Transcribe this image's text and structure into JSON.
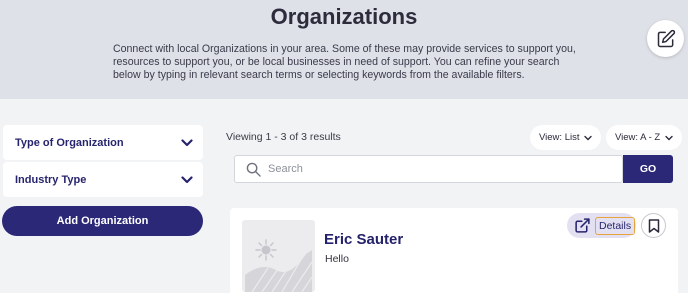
{
  "header": {
    "title": "Organizations",
    "intro": "Connect with local Organizations in your area. Some of these may provide services to support you, resources to support you, or be local businesses in need of support. You can refine your search below by typing in relevant search terms or selecting keywords from the available filters.",
    "edit_icon": "edit-icon"
  },
  "filters": [
    {
      "label": "Type of Organization",
      "icon": "chevron-down-icon"
    },
    {
      "label": "Industry Type",
      "icon": "chevron-down-icon"
    }
  ],
  "add_organization_label": "Add Organization",
  "results": {
    "count_text": "Viewing 1 - 3 of 3 results",
    "view_mode": "View: List",
    "sort": "View: A - Z"
  },
  "search": {
    "placeholder": "Search",
    "value": "",
    "go_label": "GO"
  },
  "items": [
    {
      "name": "Eric Sauter",
      "description": "Hello",
      "details_label": "Details",
      "details_icon": "external-link-icon",
      "bookmark_icon": "bookmark-icon"
    }
  ],
  "colors": {
    "brand": "#2b2877",
    "header_bg": "#dfe1e8",
    "page_bg": "#f2f3f5",
    "highlight": "#e8a33c"
  }
}
